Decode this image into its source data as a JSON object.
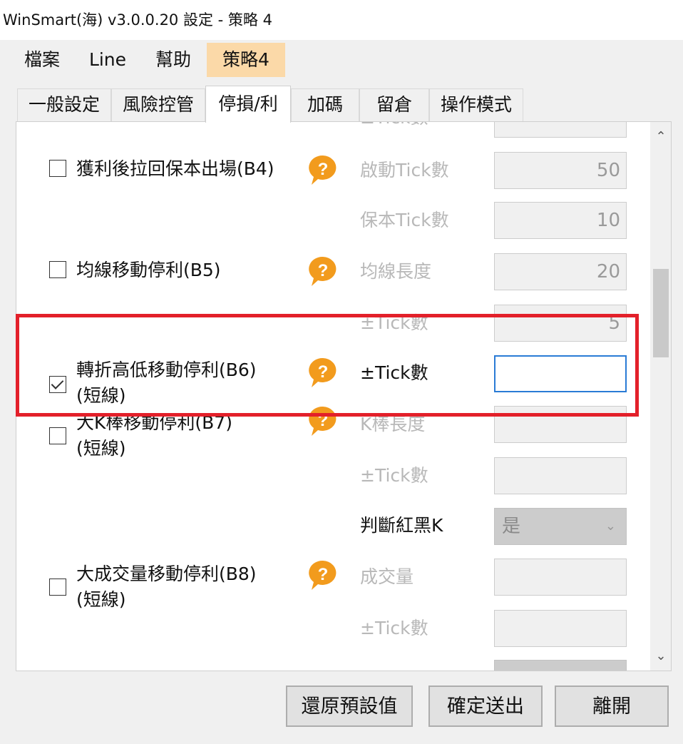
{
  "window": {
    "title": "WinSmart(海) v3.0.0.20 設定 - 策略 4"
  },
  "menu": {
    "items": [
      "檔案",
      "Line",
      "幫助",
      "策略4"
    ],
    "active_index": 3
  },
  "tabs": {
    "items": [
      "一般設定",
      "風險控管",
      "停損/利",
      "加碼",
      "留倉",
      "操作模式"
    ],
    "active_index": 2
  },
  "rows": [
    {
      "label_lines": [
        "獲利後拉回保本出場(B4)"
      ],
      "checked": false,
      "fields": [
        {
          "label": "啟動Tick數",
          "value": "50",
          "enabled": false
        },
        {
          "label": "保本Tick數",
          "value": "10",
          "enabled": false
        }
      ]
    },
    {
      "label_lines": [
        "均線移動停利(B5)"
      ],
      "checked": false,
      "fields": [
        {
          "label": "均線長度",
          "value": "20",
          "enabled": false
        },
        {
          "label": "±Tick數",
          "value": "5",
          "enabled": false
        }
      ]
    },
    {
      "label_lines": [
        "轉折高低移動停利(B6)",
        "(短線)"
      ],
      "checked": true,
      "fields": [
        {
          "label": "±Tick數",
          "value": "",
          "enabled": true
        }
      ]
    },
    {
      "label_lines": [
        "大K棒移動停利(B7)",
        "(短線)"
      ],
      "checked": false,
      "fields": [
        {
          "label": "K棒長度",
          "value": "",
          "enabled": false
        },
        {
          "label": "±Tick數",
          "value": "",
          "enabled": false
        },
        {
          "label": "判斷紅黑K",
          "value": "是",
          "enabled": false,
          "type": "select"
        }
      ]
    },
    {
      "label_lines": [
        "大成交量移動停利(B8)",
        "(短線)"
      ],
      "checked": false,
      "fields": [
        {
          "label": "成交量",
          "value": "",
          "enabled": false
        },
        {
          "label": "±Tick數",
          "value": "",
          "enabled": false
        }
      ]
    }
  ],
  "buttons": {
    "restore_default": "還原預設值",
    "confirm_send": "確定送出",
    "leave": "離開"
  },
  "colors": {
    "highlight": "#e3202a",
    "active_menu": "#fbd9a8",
    "help_icon": "#f29b1d",
    "focus_border": "#2a7bd5"
  }
}
